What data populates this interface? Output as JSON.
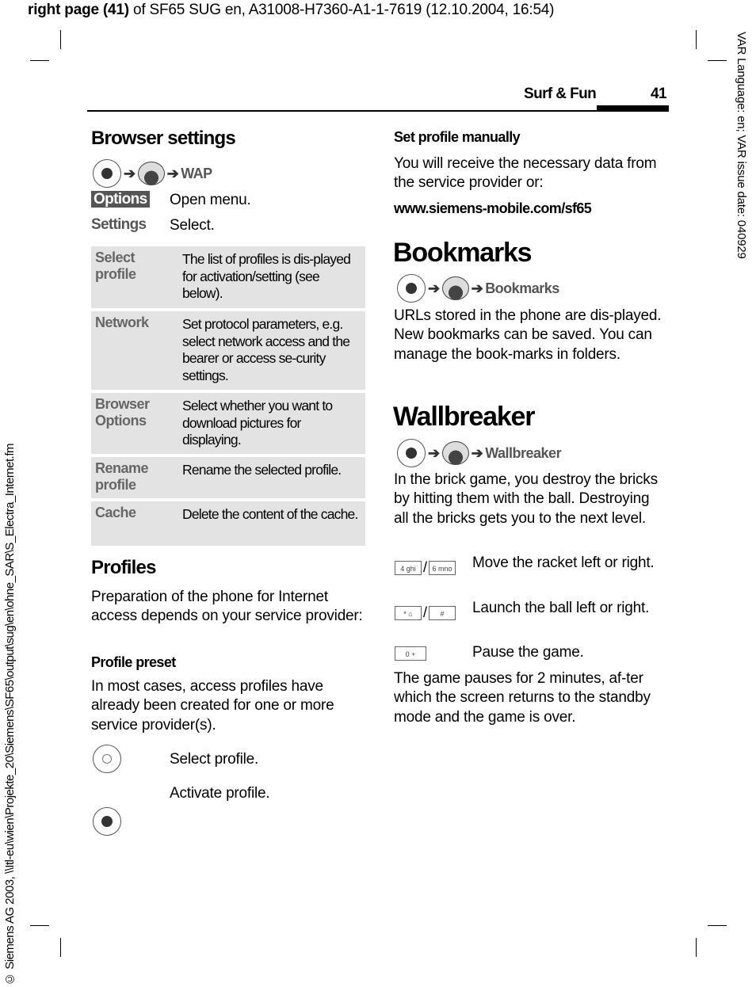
{
  "print_header": {
    "bold": "right page (41)",
    "rest": " of SF65 SUG en, A31008-H7360-A1-1-7619 (12.10.2004, 16:54)"
  },
  "side_right": "VAR Language: en; VAR issue date: 040929",
  "side_left": "© Siemens AG 2003, \\\\Itl-eu\\wien\\Projekte_20\\Siemens\\SF65\\output\\sug\\en\\ohne_SAR\\S_Electra_Internet.fm",
  "running_head": {
    "section": "Surf & Fun",
    "page": "41"
  },
  "browser_settings": {
    "title": "Browser settings",
    "path": "WAP",
    "options_key": "Options",
    "options_desc": "Open menu.",
    "settings_key": "Settings",
    "settings_desc": "Select.",
    "rows": [
      {
        "key": "Select profile",
        "desc": "The list of profiles is dis-played for activation/setting (see below)."
      },
      {
        "key": "Network",
        "desc": "Set protocol parameters, e.g. select network access and the bearer or access se-curity settings."
      },
      {
        "key": "Browser Options",
        "desc": "Select whether you want to download pictures for displaying."
      },
      {
        "key": "Rename profile",
        "desc": "Rename the selected profile."
      },
      {
        "key": "Cache",
        "desc": "Delete the content of the cache."
      }
    ]
  },
  "profiles": {
    "title": "Profiles",
    "intro": "Preparation of the phone for Internet access depends on your service provider:",
    "preset_title": "Profile preset",
    "preset_text": "In most cases, access profiles have already been created for one or more service provider(s).",
    "steps": [
      {
        "icon": "nav-up-down-icon",
        "text": "Select profile."
      },
      {
        "icon": "nav-center-icon",
        "text": "Activate profile."
      }
    ],
    "manual_title": "Set profile manually",
    "manual_text": "You will receive the necessary data from the service provider or:",
    "url": "www.siemens-mobile.com/sf65"
  },
  "bookmarks": {
    "title": "Bookmarks",
    "path": "Bookmarks",
    "text": "URLs stored in the phone are dis-played. New bookmarks can be saved. You can manage the book-marks in folders."
  },
  "wallbreaker": {
    "title": "Wallbreaker",
    "path": "Wallbreaker",
    "text": "In the brick game, you destroy the bricks by hitting them with the ball. Destroying all the bricks gets you to the next level.",
    "keys": [
      {
        "a": "4 ghi",
        "b": "6 mno",
        "text": "Move the racket left or right."
      },
      {
        "a": "* ⌂",
        "b": "#",
        "text": "Launch the ball left or right."
      },
      {
        "a": "0 +",
        "text": "Pause the game."
      }
    ],
    "footer": "The game pauses for 2 minutes, af-ter which the screen returns to the standby mode and the game is over."
  }
}
